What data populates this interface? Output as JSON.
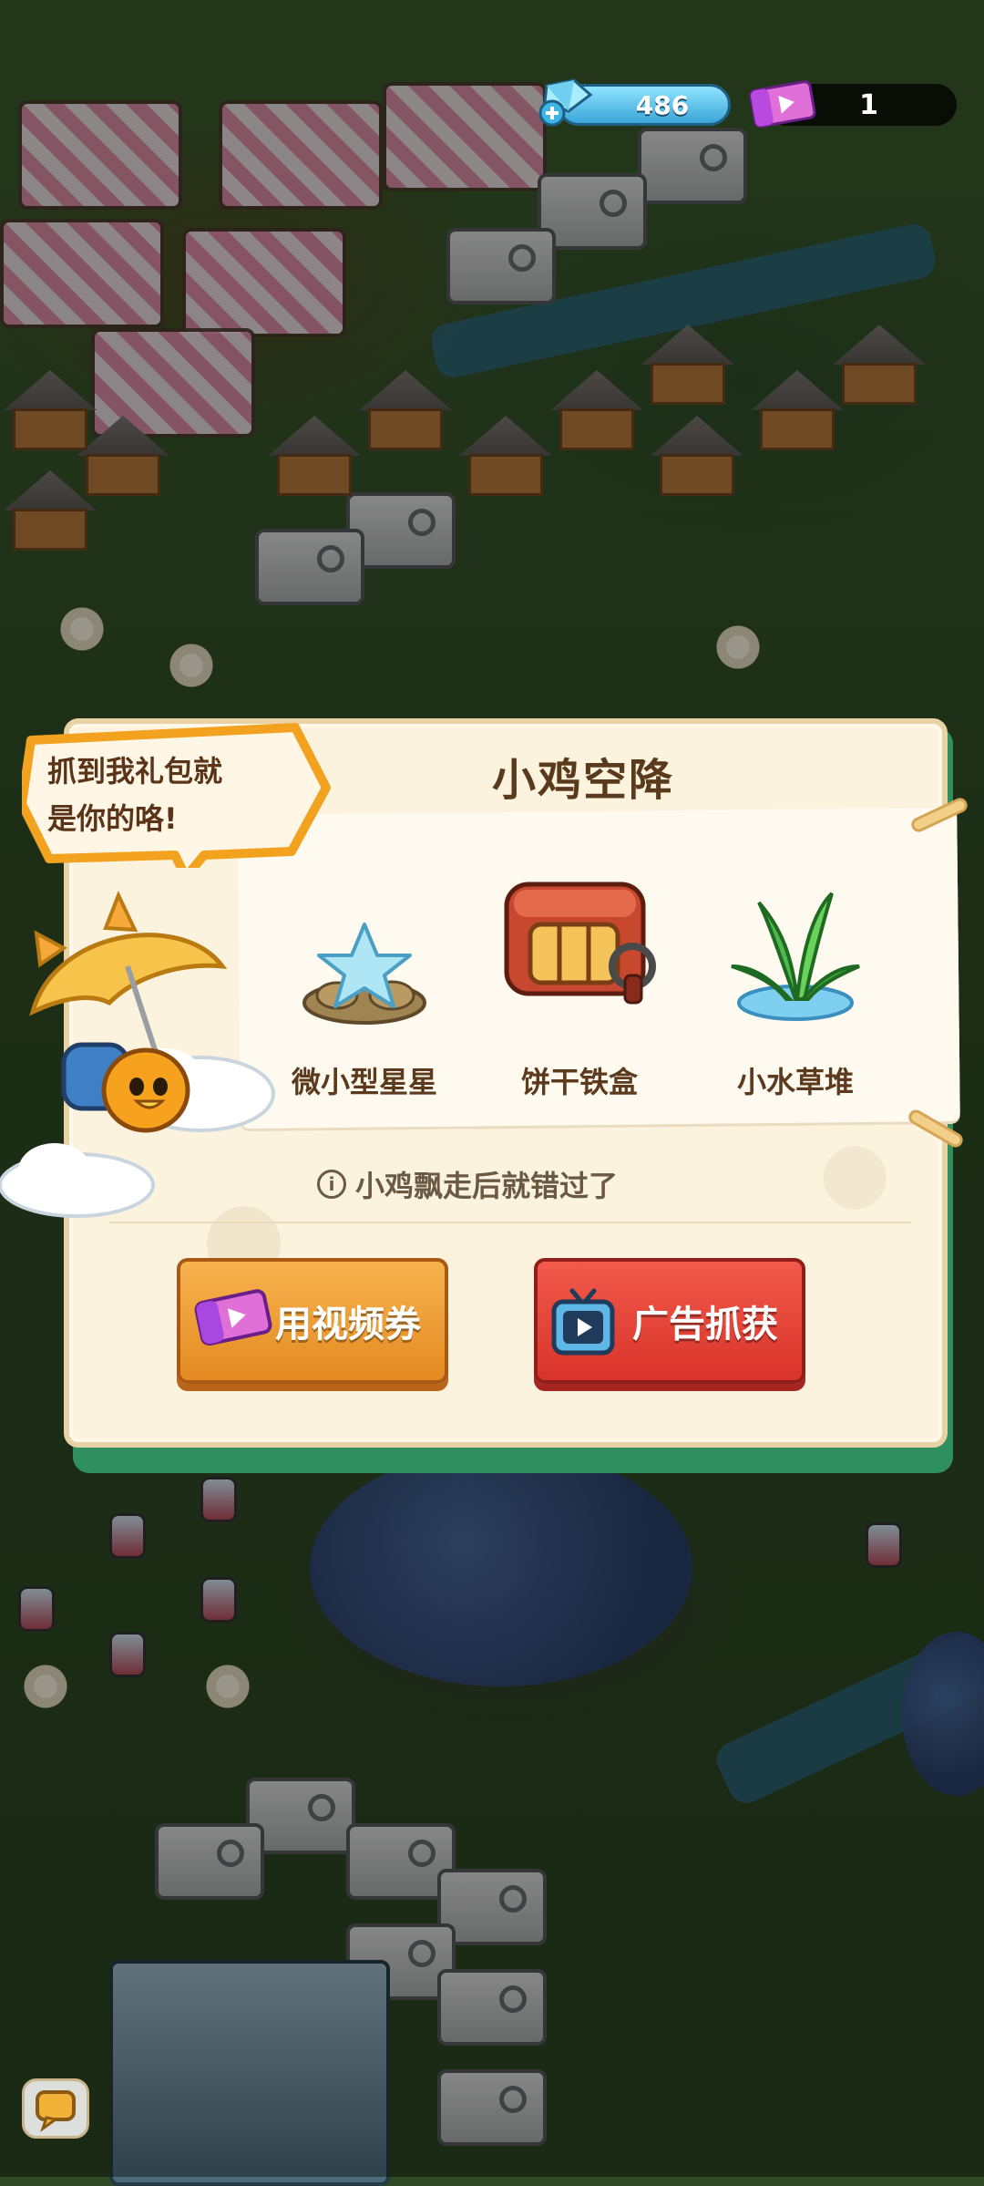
{
  "currency": {
    "gems": "486",
    "video_tickets": "1"
  },
  "popup": {
    "title": "小鸡空降",
    "speech_bubble": {
      "line1": "抓到我礼包就",
      "line2": "是你的咯!"
    },
    "rewards": [
      {
        "label": "微小型星星",
        "icon": "star-on-rock-icon"
      },
      {
        "label": "饼干铁盒",
        "icon": "cookie-tin-icon"
      },
      {
        "label": "小水草堆",
        "icon": "water-grass-icon"
      }
    ],
    "hint": "小鸡飘走后就错过了",
    "buttons": {
      "use_ticket": "用视频券",
      "watch_ad": "广告抓获"
    }
  },
  "colors": {
    "panel_bg": "#fbf3de",
    "title": "#5a3a1c",
    "btn_orange": "#e48a22",
    "btn_red": "#d9332a",
    "gem_blue": "#3aa6d8"
  }
}
